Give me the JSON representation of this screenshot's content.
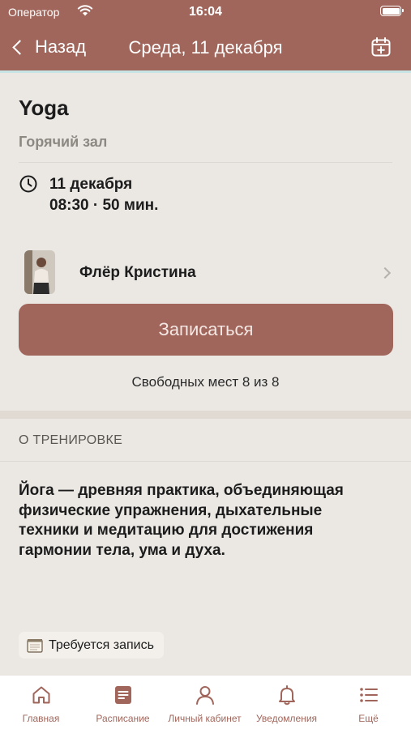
{
  "status_bar": {
    "carrier": "Оператор",
    "time": "16:04"
  },
  "nav": {
    "back_label": "Назад",
    "title": "Среда, 11 декабря",
    "calendar_icon": "calendar-plus-icon"
  },
  "workout": {
    "title": "Yoga",
    "hall": "Горячий зал",
    "date": "11 декабря",
    "time_duration": "08:30 · 50 мин.",
    "trainer_name": "Флёр Кристина",
    "signup_label": "Записаться",
    "seats_text": "Свободных мест 8 из 8"
  },
  "about": {
    "heading": "О ТРЕНИРОВКЕ",
    "description": "Йога — древняя практика, объединяющая физические упражнения, дыхательные техники и медитацию для достижения гармонии тела, ума и духа.",
    "tag_label": "Требуется запись"
  },
  "tabbar": {
    "items": [
      {
        "label": "Главная",
        "icon": "home-icon"
      },
      {
        "label": "Расписание",
        "icon": "schedule-icon"
      },
      {
        "label": "Личный кабинет",
        "icon": "profile-icon"
      },
      {
        "label": "Уведомления",
        "icon": "bell-icon"
      },
      {
        "label": "Ещё",
        "icon": "more-list-icon"
      }
    ]
  },
  "colors": {
    "accent": "#a1665b",
    "background": "#ebe8e4",
    "tabbar": "#ffffff"
  }
}
